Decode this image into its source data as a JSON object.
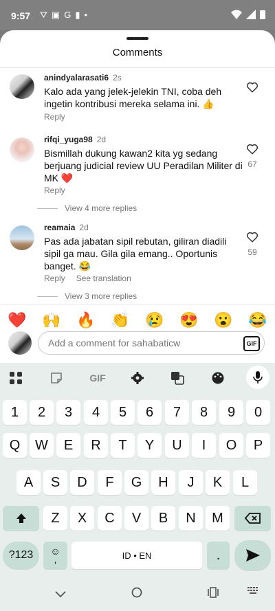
{
  "status": {
    "time": "9:57"
  },
  "sheet": {
    "title": "Comments"
  },
  "comments": [
    {
      "user": "anindyalarasati6",
      "time": "2s",
      "text": "Kalo ada yang jelek-jelekin TNI, coba deh ingetin kontribusi mereka selama ini. 👍",
      "reply": "Reply",
      "likes": ""
    },
    {
      "user": "rifqi_yuga98",
      "time": "2d",
      "text": "Bismillah dukung kawan2 kita yg sedang berjuang judicial review UU Peradilan Militer di MK ❤️",
      "reply": "Reply",
      "likes": "67",
      "more": "View 4 more replies"
    },
    {
      "user": "reamaia",
      "time": "2d",
      "text": "Pas ada jabatan sipil rebutan, giliran diadili sipil ga mau. Gila gila emang.. Oportunis banget. 😂",
      "reply": "Reply",
      "see_translation": "See translation",
      "likes": "59",
      "more": "View 3 more replies"
    }
  ],
  "emojis": [
    "❤️",
    "🙌",
    "🔥",
    "👏",
    "😢",
    "😍",
    "😮",
    "😂"
  ],
  "comment_input": {
    "placeholder": "Add a comment for sahabaticw",
    "gif": "GIF"
  },
  "keyboard": {
    "toolbar": {
      "gif": "GIF"
    },
    "row_numbers": [
      "1",
      "2",
      "3",
      "4",
      "5",
      "6",
      "7",
      "8",
      "9",
      "0"
    ],
    "row1": [
      "Q",
      "W",
      "E",
      "R",
      "T",
      "Y",
      "U",
      "I",
      "O",
      "P"
    ],
    "row2": [
      "A",
      "S",
      "D",
      "F",
      "G",
      "H",
      "J",
      "K",
      "L"
    ],
    "row3": [
      "Z",
      "X",
      "C",
      "V",
      "B",
      "N",
      "M"
    ],
    "sym_label": "?123",
    "comma": ",",
    "emoji_small": "☺",
    "space_label": "ID • EN",
    "period": "."
  }
}
